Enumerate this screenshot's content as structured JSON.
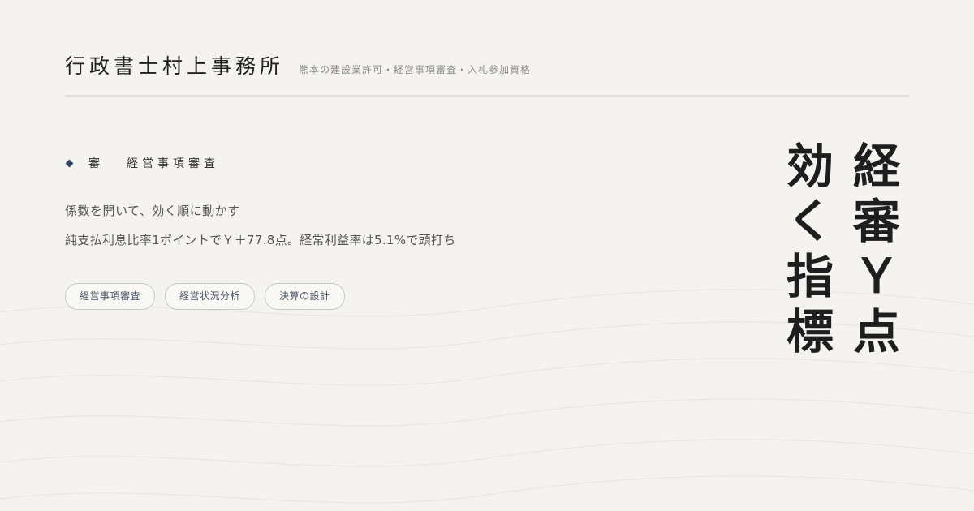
{
  "header": {
    "office_name": "行政書士村上事務所",
    "tagline": "熊本の建設業許可・経営事項審査・入札参加資格"
  },
  "category": {
    "marker_char": "審",
    "label": "経営事項審査"
  },
  "article": {
    "subtitle": "係数を開いて、効く順に動かす",
    "description": "純支払利息比率1ポイントでＹ＋77.8点。経常利益率は5.1%で頭打ち"
  },
  "tags": [
    "経営事項審査",
    "経営状況分析",
    "決算の設計"
  ],
  "vertical_title": {
    "line1": "経審Ｙ点",
    "line2": "効く指標"
  },
  "colors": {
    "background": "#f4f3ef",
    "accent": "#2d4766",
    "text": "#1e1e1e"
  }
}
